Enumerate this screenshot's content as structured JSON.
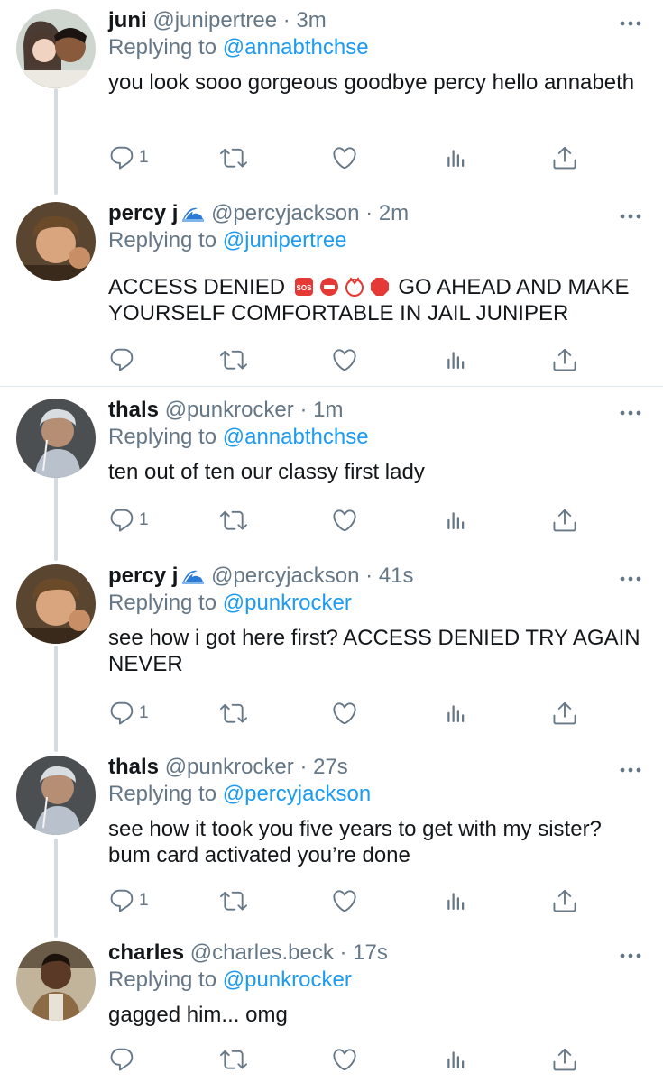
{
  "tweets": [
    {
      "name": "juni",
      "handle": "@junipertree",
      "time": "3m",
      "reply_label": "Replying to",
      "reply_to": "@annabthchse",
      "text": "you look sooo gorgeous goodbye percy hello annabeth",
      "reply_count": "1"
    },
    {
      "name": "percy j",
      "handle": "@percyjackson",
      "time": "2m",
      "reply_label": "Replying to",
      "reply_to": "@junipertree",
      "text_a": "ACCESS DENIED",
      "text_b": "GO AHEAD AND MAKE YOURSELF COMFORTABLE IN JAIL JUNIPER",
      "reply_count": "",
      "emojis": [
        "sos-icon",
        "no-entry-icon",
        "anger-icon",
        "stop-sign-icon"
      ]
    },
    {
      "name": "thals",
      "handle": "@punkrocker",
      "time": "1m",
      "reply_label": "Replying to",
      "reply_to": "@annabthchse",
      "text": "ten out of ten our classy first lady",
      "reply_count": "1"
    },
    {
      "name": "percy j",
      "handle": "@percyjackson",
      "time": "41s",
      "reply_label": "Replying to",
      "reply_to": "@punkrocker",
      "text": "see how i got here first? ACCESS DENIED TRY AGAIN NEVER",
      "reply_count": "1"
    },
    {
      "name": "thals",
      "handle": "@punkrocker",
      "time": "27s",
      "reply_label": "Replying to",
      "reply_to": "@percyjackson",
      "text": "see how it took you five years to get with my sister? bum card activated you’re done",
      "reply_count": "1"
    },
    {
      "name": "charles",
      "handle": "@charles.beck",
      "time": "17s",
      "reply_label": "Replying to",
      "reply_to": "@punkrocker",
      "text": "gagged him... omg",
      "reply_count": ""
    }
  ],
  "sep": " · ",
  "colors": {
    "accent": "#1d9bf0",
    "muted": "#657786",
    "icon": "#657786",
    "text": "#14171a",
    "thread_line": "#d6dbdf"
  },
  "icons": [
    "reply-icon",
    "retweet-icon",
    "like-icon",
    "analytics-icon",
    "share-icon",
    "more-icon",
    "wave-emoji-icon"
  ]
}
